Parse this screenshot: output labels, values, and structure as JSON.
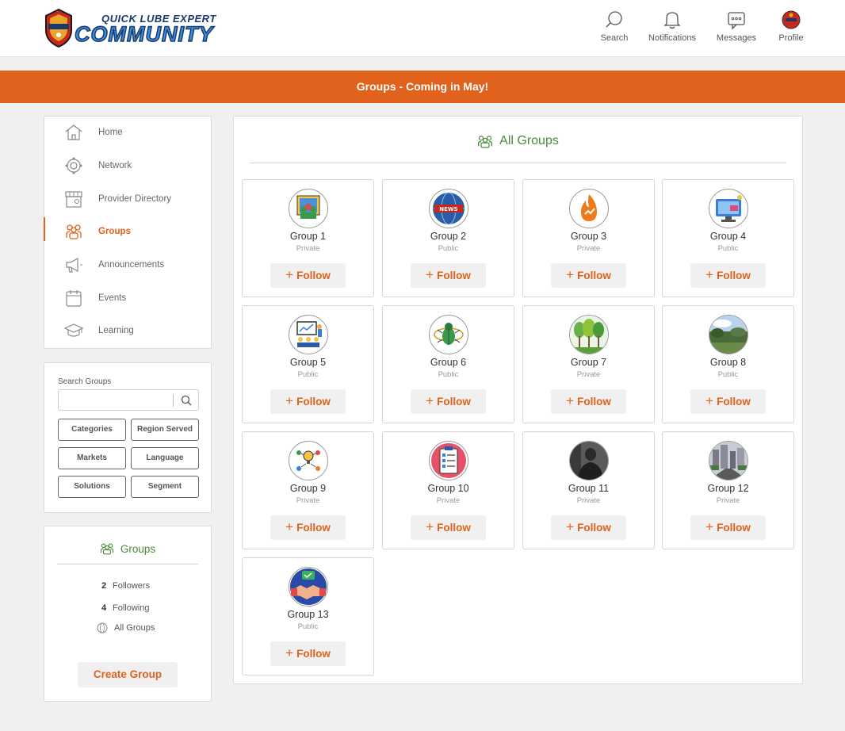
{
  "brand": {
    "tagline": "QUICK LUBE EXPERT",
    "name": "COMMUNITY",
    "badge_text": "QUICK LUBE EXPERT"
  },
  "topnav": [
    {
      "label": "Search",
      "icon": "search-icon"
    },
    {
      "label": "Notifications",
      "icon": "bell-icon"
    },
    {
      "label": "Messages",
      "icon": "message-icon"
    },
    {
      "label": "Profile",
      "icon": "avatar"
    }
  ],
  "banner": {
    "text": "Groups - Coming in May!"
  },
  "sidebar": {
    "items": [
      {
        "label": "Home",
        "icon": "home-icon",
        "active": false
      },
      {
        "label": "Network",
        "icon": "network-icon",
        "active": false
      },
      {
        "label": "Provider Directory",
        "icon": "storefront-icon",
        "active": false
      },
      {
        "label": "Groups",
        "icon": "groups-icon",
        "active": true
      },
      {
        "label": "Announcements",
        "icon": "megaphone-icon",
        "active": false
      },
      {
        "label": "Events",
        "icon": "calendar-icon",
        "active": false
      },
      {
        "label": "Learning",
        "icon": "graduation-cap-icon",
        "active": false
      }
    ]
  },
  "search": {
    "label": "Search Groups",
    "placeholder": "",
    "value": "",
    "filters": [
      "Categories",
      "Region Served",
      "Markets",
      "Language",
      "Solutions",
      "Segment"
    ]
  },
  "stats": {
    "title": "Groups",
    "followers_count": "2",
    "followers_label": "Followers",
    "following_count": "4",
    "following_label": "Following",
    "all_groups_label": "All Groups",
    "create_label": "Create Group"
  },
  "main": {
    "title": "All Groups",
    "follow_label": "Follow",
    "groups": [
      {
        "name": "Group 1",
        "privacy": "Private",
        "icon": "team-presentation-icon"
      },
      {
        "name": "Group 2",
        "privacy": "Public",
        "icon": "globe-news-icon"
      },
      {
        "name": "Group 3",
        "privacy": "Private",
        "icon": "flame-growth-icon"
      },
      {
        "name": "Group 4",
        "privacy": "Public",
        "icon": "monitor-ad-icon"
      },
      {
        "name": "Group 5",
        "privacy": "Public",
        "icon": "conference-icon"
      },
      {
        "name": "Group 6",
        "privacy": "Public",
        "icon": "bug-icon"
      },
      {
        "name": "Group 7",
        "privacy": "Private",
        "icon": "forest-icon"
      },
      {
        "name": "Group 8",
        "privacy": "Public",
        "icon": "landscape-photo-icon"
      },
      {
        "name": "Group 9",
        "privacy": "Private",
        "icon": "idea-team-icon"
      },
      {
        "name": "Group 10",
        "privacy": "Private",
        "icon": "clipboard-checklist-icon"
      },
      {
        "name": "Group 11",
        "privacy": "Private",
        "icon": "person-photo-icon"
      },
      {
        "name": "Group 12",
        "privacy": "Private",
        "icon": "city-street-photo-icon"
      },
      {
        "name": "Group 13",
        "privacy": "Public",
        "icon": "handshake-icon"
      }
    ]
  },
  "colors": {
    "accent": "#e0621c",
    "green": "#4a8a3a",
    "navy": "#1a3a6e",
    "blue": "#3b8fd9"
  }
}
